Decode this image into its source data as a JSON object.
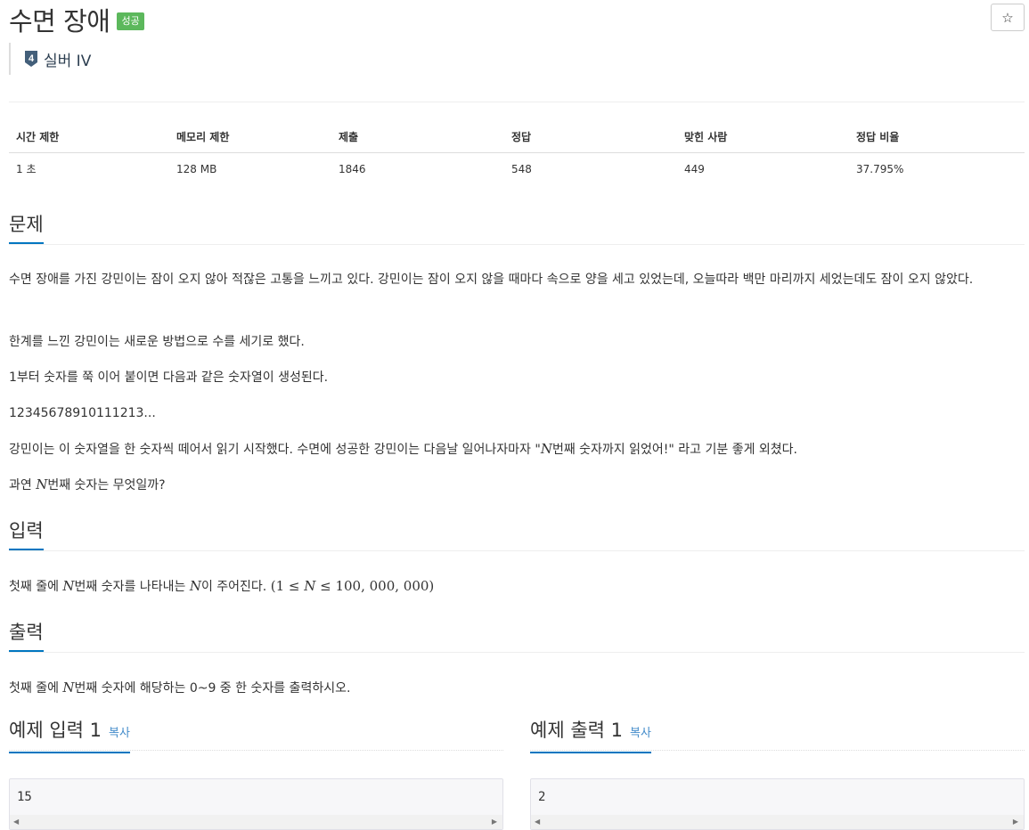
{
  "problem": {
    "title": "수면 장애",
    "status_badge": "성공",
    "tier_number": "4",
    "tier_label": "실버 IV"
  },
  "star_icon_glyph": "☆",
  "stats": {
    "headers": [
      "시간 제한",
      "메모리 제한",
      "제출",
      "정답",
      "맞힌 사람",
      "정답 비율"
    ],
    "values": [
      "1 초",
      "128 MB",
      "1846",
      "548",
      "449",
      "37.795%"
    ]
  },
  "sections": {
    "problem_heading": "문제",
    "input_heading": "입력",
    "output_heading": "출력"
  },
  "problem_text": {
    "p1": "수면 장애를 가진 강민이는 잠이 오지 않아 적잖은 고통을 느끼고 있다. 강민이는 잠이 오지 않을 때마다 속으로 양을 세고 있었는데, 오늘따라 백만 마리까지 세었는데도 잠이 오지 않았다.",
    "p2": "한계를 느낀 강민이는 새로운 방법으로 수를 세기로 했다.",
    "p3": "1부터 숫자를 쭉 이어 붙이면 다음과 같은 숫자열이 생성된다.",
    "p4": "12345678910111213...",
    "p5_pre": "강민이는 이 숫자열을 한 숫자씩 떼어서 읽기 시작했다. 수면에 성공한 강민이는 다음날 일어나자마자 \"",
    "p5_var": "N",
    "p5_post": "번째 숫자까지 읽었어!\" 라고 기분 좋게 외쳤다.",
    "p6_pre": "과연 ",
    "p6_var": "N",
    "p6_post": "번째 숫자는 무엇일까?"
  },
  "input_text": {
    "pre": "첫째 줄에 ",
    "var1": "N",
    "mid": "번째 숫자를 나타내는 ",
    "var2": "N",
    "post": "이 주어진다. ",
    "range_open": "(1 ≤ ",
    "range_var": "N",
    "range_close": " ≤ 100, 000, 000)"
  },
  "output_text": {
    "pre": "첫째 줄에 ",
    "var": "N",
    "post": "번째 숫자에 해당하는 0~9 중 한 숫자를 출력하시오."
  },
  "samples": {
    "input_heading": "예제 입력 1",
    "output_heading": "예제 출력 1",
    "copy_label": "복사",
    "input_value": "15",
    "output_value": "2"
  },
  "colors": {
    "badge_success": "#5cb85c",
    "heading_underline": "#0076c0",
    "link": "#428bca",
    "tier_silver": "#435f7a"
  }
}
